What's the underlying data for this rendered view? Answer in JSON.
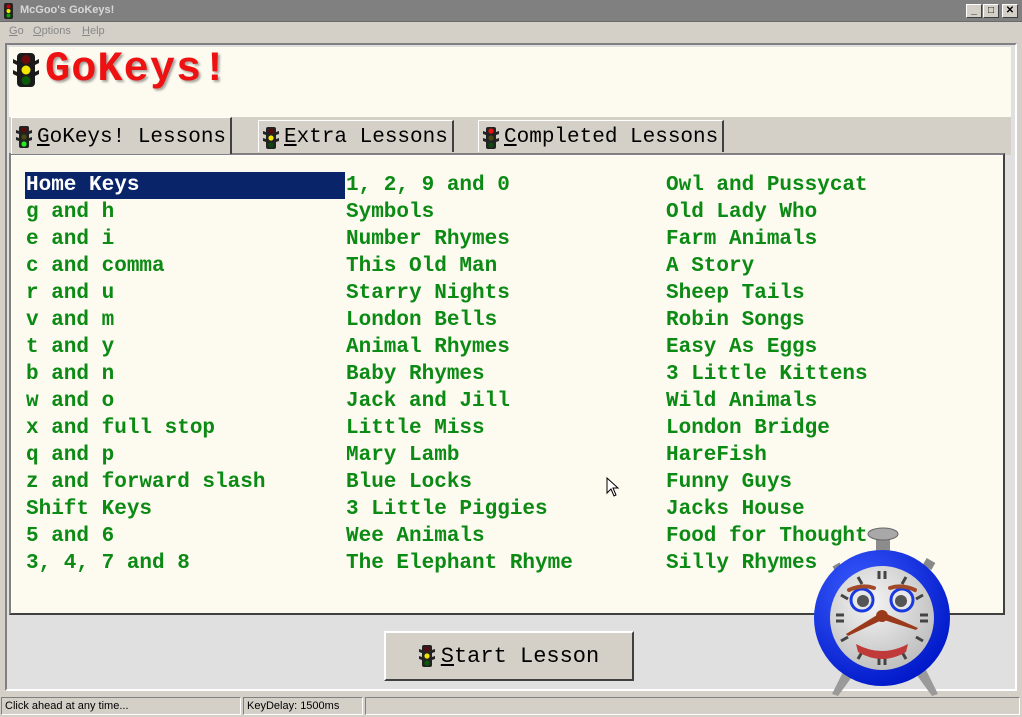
{
  "window": {
    "title": "McGoo's GoKeys!",
    "controls": [
      "minimize",
      "maximize",
      "close"
    ]
  },
  "menu": {
    "items": [
      {
        "label": "Go",
        "mnemonic": "G"
      },
      {
        "label": "Options",
        "mnemonic": "O"
      },
      {
        "label": "Help",
        "mnemonic": "H"
      }
    ]
  },
  "header": {
    "brand": "GoKeys!",
    "icon": "traffic-light-icon"
  },
  "tabs": [
    {
      "label": "GoKeys! Lessons",
      "mnemonic": "G",
      "rest": "oKeys! Lessons",
      "active": true,
      "icon": "traffic-light-green-icon"
    },
    {
      "label": "Extra Lessons",
      "mnemonic": "E",
      "rest": "xtra Lessons",
      "active": false,
      "icon": "traffic-light-yellow-icon"
    },
    {
      "label": "Completed Lessons",
      "mnemonic": "C",
      "rest": "ompleted Lessons",
      "active": false,
      "icon": "traffic-light-red-icon"
    }
  ],
  "lessons": {
    "selected": "Home Keys",
    "columns": [
      [
        "Home Keys",
        "g and h",
        "e and i",
        "c and comma",
        "r and u",
        "v and m",
        "t and y",
        "b and n",
        "w and o",
        "x and full stop",
        "q and p",
        "z and forward slash",
        "Shift Keys",
        "5 and 6",
        "3, 4, 7 and 8"
      ],
      [
        "1, 2, 9 and 0",
        "Symbols",
        "Number Rhymes",
        "This Old Man",
        "Starry Nights",
        "London Bells",
        "Animal Rhymes",
        "Baby Rhymes",
        "Jack and Jill",
        "Little Miss",
        "Mary Lamb",
        "Blue Locks",
        "3 Little Piggies",
        "Wee Animals",
        "The Elephant Rhyme"
      ],
      [
        "Owl and Pussycat",
        "Old Lady Who",
        "Farm Animals",
        "A Story",
        "Sheep Tails",
        "Robin Songs",
        "Easy As Eggs",
        "3 Little Kittens",
        "Wild Animals",
        "London Bridge",
        "HareFish",
        "Funny Guys",
        "Jacks House",
        "Food for Thought",
        "Silly Rhymes"
      ]
    ]
  },
  "actions": {
    "start_lesson": {
      "label": "Start Lesson",
      "mnemonic": "S",
      "rest": "tart Lesson"
    }
  },
  "status": {
    "hint": "Click ahead at any time...",
    "key_delay": "KeyDelay: 1500ms",
    "extra": ""
  },
  "colors": {
    "brand_red": "#ee1111",
    "lesson_green": "#0b8a14",
    "selection_bg": "#0a246a",
    "panel_bg": "#fdfaf0",
    "clock_blue": "#0a2ee6"
  }
}
